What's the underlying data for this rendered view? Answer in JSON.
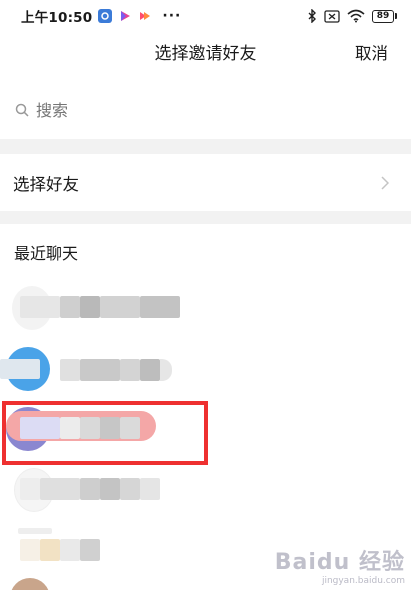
{
  "status_bar": {
    "time": "上午10:50",
    "dots": "···",
    "battery": "89"
  },
  "nav": {
    "title": "选择邀请好友",
    "cancel_label": "取消"
  },
  "search": {
    "placeholder": "搜索"
  },
  "select_friends": {
    "label": "选择好友"
  },
  "recent_chats": {
    "title": "最近聊天"
  },
  "watermark": {
    "main": "Baidu 经验",
    "sub": "jingyan.baidu.com"
  },
  "colors": {
    "highlight": "#ee3030",
    "band": "#f2f2f2"
  }
}
